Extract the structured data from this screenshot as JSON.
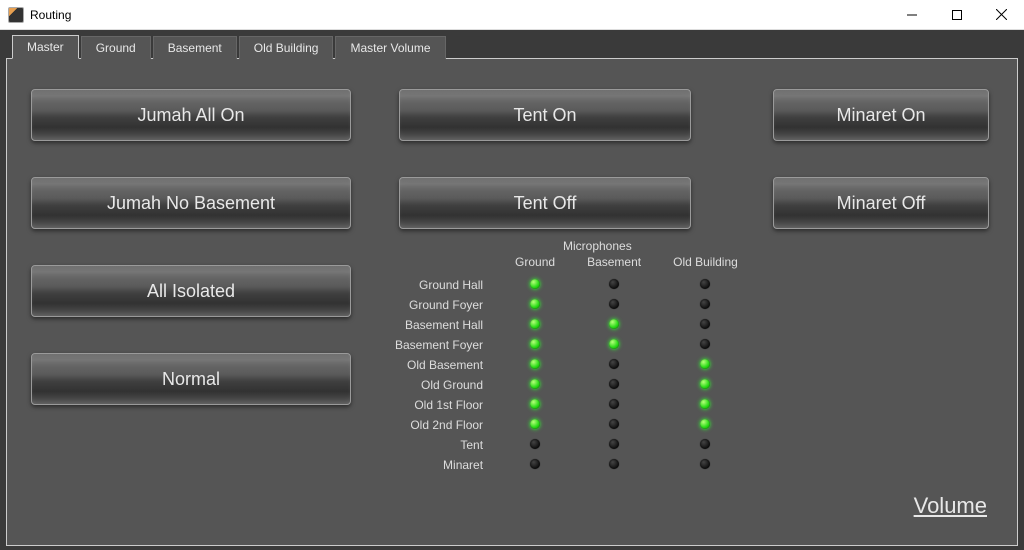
{
  "window": {
    "title": "Routing"
  },
  "tabs": [
    {
      "label": "Master",
      "active": true
    },
    {
      "label": "Ground",
      "active": false
    },
    {
      "label": "Basement",
      "active": false
    },
    {
      "label": "Old Building",
      "active": false
    },
    {
      "label": "Master Volume",
      "active": false
    }
  ],
  "buttons": {
    "jumah_on": "Jumah All On",
    "jumah_nob": "Jumah No Basement",
    "isolated": "All Isolated",
    "normal": "Normal",
    "tent_on": "Tent On",
    "tent_off": "Tent Off",
    "min_on": "Minaret On",
    "min_off": "Minaret Off"
  },
  "matrix": {
    "group_header": "Microphones",
    "columns": [
      "Ground",
      "Basement",
      "Old Building"
    ],
    "rows": [
      {
        "label": "Ground Hall",
        "cells": [
          true,
          false,
          false
        ]
      },
      {
        "label": "Ground Foyer",
        "cells": [
          true,
          false,
          false
        ]
      },
      {
        "label": "Basement Hall",
        "cells": [
          true,
          true,
          false
        ]
      },
      {
        "label": "Basement Foyer",
        "cells": [
          true,
          true,
          false
        ]
      },
      {
        "label": "Old Basement",
        "cells": [
          true,
          false,
          true
        ]
      },
      {
        "label": "Old Ground",
        "cells": [
          true,
          false,
          true
        ]
      },
      {
        "label": "Old 1st Floor",
        "cells": [
          true,
          false,
          true
        ]
      },
      {
        "label": "Old 2nd Floor",
        "cells": [
          true,
          false,
          true
        ]
      },
      {
        "label": "Tent",
        "cells": [
          false,
          false,
          false
        ]
      },
      {
        "label": "Minaret",
        "cells": [
          false,
          false,
          false
        ]
      }
    ]
  },
  "volume_link": "Volume"
}
